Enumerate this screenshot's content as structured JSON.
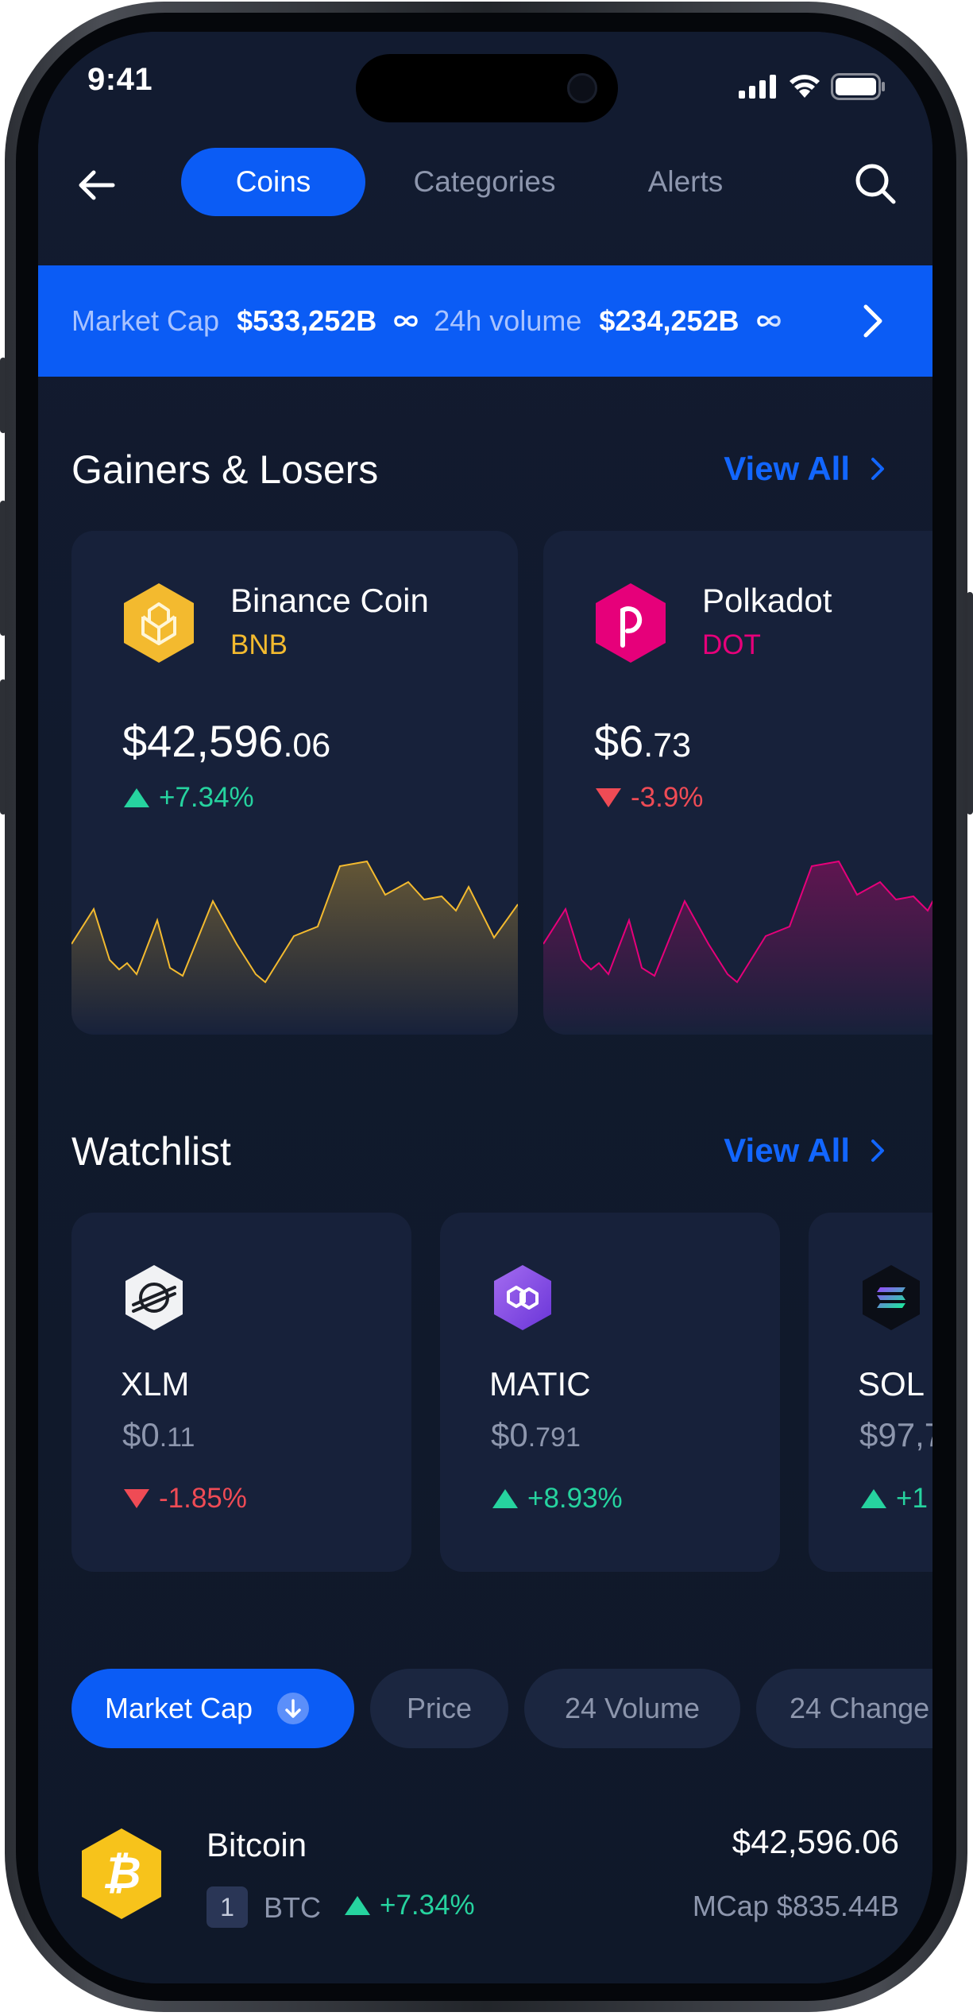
{
  "status_bar": {
    "time": "9:41"
  },
  "nav": {
    "tabs": [
      {
        "label": "Coins",
        "active": true
      },
      {
        "label": "Categories",
        "active": false
      },
      {
        "label": "Alerts",
        "active": false
      }
    ],
    "back_icon": "arrow-left-icon",
    "search_icon": "search-icon"
  },
  "market_banner": {
    "market_cap_label": "Market Cap",
    "market_cap_value": "$533,252B",
    "volume_label": "24h volume",
    "volume_value": "$234,252B"
  },
  "gainers": {
    "title": "Gainers & Losers",
    "view_all": "View All",
    "cards": [
      {
        "name": "Binance Coin",
        "symbol": "BNB",
        "price_main": "$42,596",
        "price_decimals": ".06",
        "change": "+7.34%",
        "direction": "up",
        "color": "#f3ba2f"
      },
      {
        "name": "Polkadot",
        "symbol": "DOT",
        "price_main": "$6",
        "price_decimals": ".73",
        "change": "-3.9%",
        "direction": "down",
        "color": "#e6007a"
      }
    ]
  },
  "watchlist": {
    "title": "Watchlist",
    "view_all": "View All",
    "cards": [
      {
        "symbol": "XLM",
        "price_main": "$0",
        "price_decimals": ".11",
        "change": "-1.85%",
        "direction": "down"
      },
      {
        "symbol": "MATIC",
        "price_main": "$0",
        "price_decimals": ".791",
        "change": "+8.93%",
        "direction": "up"
      },
      {
        "symbol": "SOL",
        "price_main": "$97,7",
        "price_decimals": "",
        "change": "+1",
        "direction": "up"
      }
    ]
  },
  "filters": {
    "chips": [
      {
        "label": "Market Cap",
        "active": true
      },
      {
        "label": "Price",
        "active": false
      },
      {
        "label": "24 Volume",
        "active": false
      },
      {
        "label": "24 Change",
        "active": false
      }
    ]
  },
  "coin_list": [
    {
      "name": "Bitcoin",
      "rank": "1",
      "symbol": "BTC",
      "change": "+7.34%",
      "price": "$42,596.06",
      "mcap": "MCap $835.44B"
    }
  ]
}
